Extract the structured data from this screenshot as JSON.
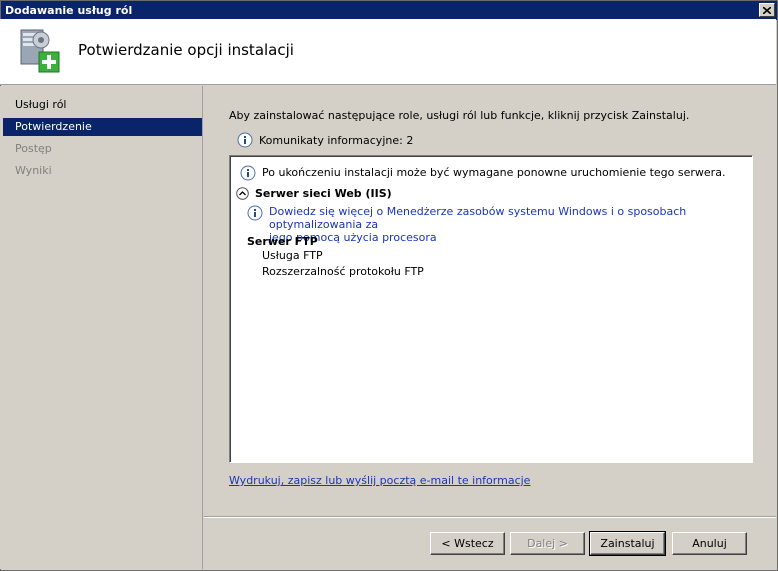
{
  "window": {
    "title": "Dodawanie usług ról"
  },
  "header": {
    "title": "Potwierdzanie opcji instalacji",
    "icon": "server-add-icon"
  },
  "sidebar": {
    "items": [
      {
        "label": "Usługi ról",
        "state": "normal"
      },
      {
        "label": "Potwierdzenie",
        "state": "active"
      },
      {
        "label": "Postęp",
        "state": "disabled"
      },
      {
        "label": "Wyniki",
        "state": "disabled"
      }
    ]
  },
  "main": {
    "intro": "Aby zainstalować następujące role, usługi ról lub funkcje, kliknij przycisk Zainstaluj.",
    "message_count": "Komunikaty informacyjne: 2",
    "restart_note": "Po ukończeniu instalacji może być wymagane ponowne uruchomienie tego serwera.",
    "group_title": "Serwer sieci Web (IIS)",
    "learn_more_line1": "Dowiedz się więcej o Menedżerze zasobów systemu Windows i o sposobach optymalizowania za",
    "learn_more_line2": "jego pomocą użycia procesora",
    "ftp_heading": "Serwer FTP",
    "ftp_items": [
      "Usługa FTP",
      "Rozszerzalność protokołu FTP"
    ]
  },
  "footer": {
    "link": "Wydrukuj, zapisz lub wyślij pocztą e-mail te informacje",
    "back": "< Wstecz",
    "next": "Dalej >",
    "install": "Zainstaluj",
    "cancel": "Anuluj"
  },
  "colors": {
    "selection": "#0a246a",
    "link": "#1a35b5",
    "dialog": "#d4d0c8"
  }
}
